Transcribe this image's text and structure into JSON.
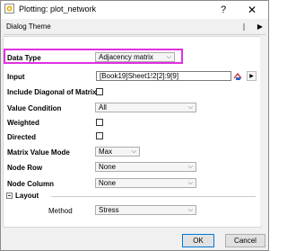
{
  "window": {
    "title": "Plotting: plot_network",
    "help_glyph": "?",
    "close_glyph": "✕",
    "app_icon": "origin-app-icon"
  },
  "theme": {
    "label": "Dialog Theme",
    "arrow_glyph": "▶"
  },
  "fields": {
    "data_type": {
      "label": "Data Type",
      "value": "Adjacency matrix"
    },
    "input": {
      "label": "Input",
      "value": "[Book19]Sheet1!2[2]:9[9]"
    },
    "include_diagonal": {
      "label": "Include Diagonal of Matrix",
      "checked": false
    },
    "value_condition": {
      "label": "Value Condition",
      "value": "All"
    },
    "weighted": {
      "label": "Weighted",
      "checked": false
    },
    "directed": {
      "label": "Directed",
      "checked": false
    },
    "matrix_value_mode": {
      "label": "Matrix Value Mode",
      "value": "Max"
    },
    "node_row": {
      "label": "Node Row",
      "value": "None"
    },
    "node_column": {
      "label": "Node Column",
      "value": "None"
    }
  },
  "layout": {
    "label": "Layout",
    "method_label": "Method",
    "method_value": "Stress"
  },
  "buttons": {
    "ok": "OK",
    "cancel": "Cancel"
  },
  "dropdown_glyph": "⌵",
  "arrow_small": "▶",
  "highlight_color": "#e030e0"
}
